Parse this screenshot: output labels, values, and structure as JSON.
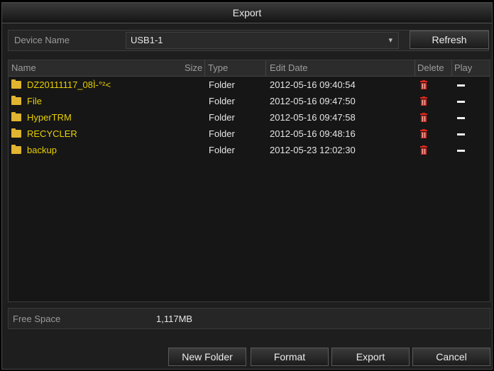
{
  "window": {
    "title": "Export"
  },
  "device": {
    "label": "Device Name",
    "value": "USB1-1",
    "refresh_label": "Refresh"
  },
  "table": {
    "columns": {
      "name": "Name",
      "size": "Size",
      "type": "Type",
      "edit_date": "Edit Date",
      "delete": "Delete",
      "play": "Play"
    },
    "rows": [
      {
        "name": "DZ20111117_08Ì-°²<",
        "type": "Folder",
        "edit_date": "2012-05-16 09:40:54"
      },
      {
        "name": "File",
        "type": "Folder",
        "edit_date": "2012-05-16 09:47:50"
      },
      {
        "name": "HyperTRM",
        "type": "Folder",
        "edit_date": "2012-05-16 09:47:58"
      },
      {
        "name": "RECYCLER",
        "type": "Folder",
        "edit_date": "2012-05-16 09:48:16"
      },
      {
        "name": "backup",
        "type": "Folder",
        "edit_date": "2012-05-23 12:02:30"
      }
    ]
  },
  "free_space": {
    "label": "Free Space",
    "value": "1,117MB"
  },
  "buttons": {
    "new_folder": "New Folder",
    "format": "Format",
    "export": "Export",
    "cancel": "Cancel"
  },
  "icons": {
    "folder": "folder-icon",
    "delete": "trash-icon",
    "play": "play-disabled-icon",
    "dropdown": "chevron-down-icon"
  },
  "colors": {
    "folder_name": "#e8d000",
    "delete_icon": "#d8291f",
    "background": "#1e1e1e"
  }
}
